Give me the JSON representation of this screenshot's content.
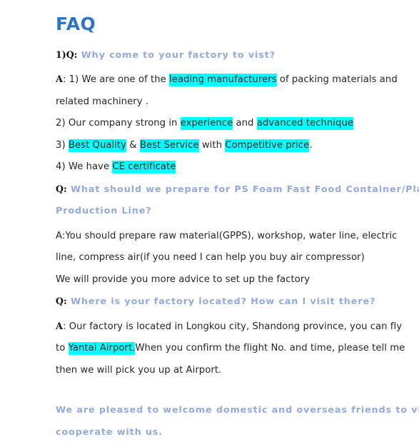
{
  "document": {
    "title": "FAQ",
    "title_color": "#2E75C8",
    "highlight_color": "#00FFFF",
    "question_color": "#93A9E0",
    "body_color": "#2A2A2A",
    "background_color": "#FFFFFF"
  },
  "faq": [
    {
      "label": "1)Q:",
      "question": "Why come to your factory to vist?",
      "answer_label": "A:",
      "answer_lines": [
        [
          {
            "text": "A",
            "style": "lead"
          },
          {
            "text": ": 1) We are one of the ",
            "style": "plain"
          },
          {
            "text": "leading manufacturers",
            "style": "highlight"
          },
          {
            "text": " of packing materials and",
            "style": "plain"
          }
        ],
        [
          {
            "text": "related machinery .",
            "style": "plain"
          }
        ],
        [
          {
            "text": "2) Our company strong in ",
            "style": "plain"
          },
          {
            "text": "experience",
            "style": "highlight"
          },
          {
            "text": " and ",
            "style": "plain"
          },
          {
            "text": "advanced technique",
            "style": "highlight"
          }
        ],
        [
          {
            "text": "3) ",
            "style": "plain"
          },
          {
            "text": "Best Quality",
            "style": "highlight"
          },
          {
            "text": " & ",
            "style": "plain"
          },
          {
            "text": "Best Service",
            "style": "highlight"
          },
          {
            "text": " with ",
            "style": "plain"
          },
          {
            "text": "Competitive price",
            "style": "highlight"
          },
          {
            "text": ".",
            "style": "plain"
          }
        ],
        [
          {
            "text": "4) We have ",
            "style": "plain"
          },
          {
            "text": "CE certificate",
            "style": "highlight"
          }
        ]
      ]
    },
    {
      "label": "Q:",
      "question_lines": [
        "What should we prepare for PS Foam Fast Food Container/Plate",
        "Production Line?"
      ],
      "answer_lines": [
        [
          {
            "text": "A:You should prepare raw material(GPPS), workshop, water line, electric",
            "style": "plain"
          }
        ],
        [
          {
            "text": "line, compress air(if you need I can help you buy air compressor)",
            "style": "plain"
          }
        ],
        [
          {
            "text": "We will provide you more advice to set up the factory",
            "style": "plain"
          }
        ]
      ]
    },
    {
      "label": "Q:",
      "question": "Where is your factory located? How can I visit there?",
      "answer_lines": [
        [
          {
            "text": "A",
            "style": "lead"
          },
          {
            "text": ": Our factory is located in Longkou city, Shandong province, you can fly",
            "style": "plain"
          }
        ],
        [
          {
            "text": "to ",
            "style": "plain"
          },
          {
            "text": "Yantai Airport.",
            "style": "highlight"
          },
          {
            "text": "When you confirm the flight No. and time, please tell me",
            "style": "plain"
          }
        ],
        [
          {
            "text": "then we will pick you up at Airport.",
            "style": "plain"
          }
        ]
      ]
    }
  ],
  "closing": {
    "lines": [
      "We are pleased to welcome domestic and overseas friends to visit us and",
      "cooperate with us."
    ]
  }
}
